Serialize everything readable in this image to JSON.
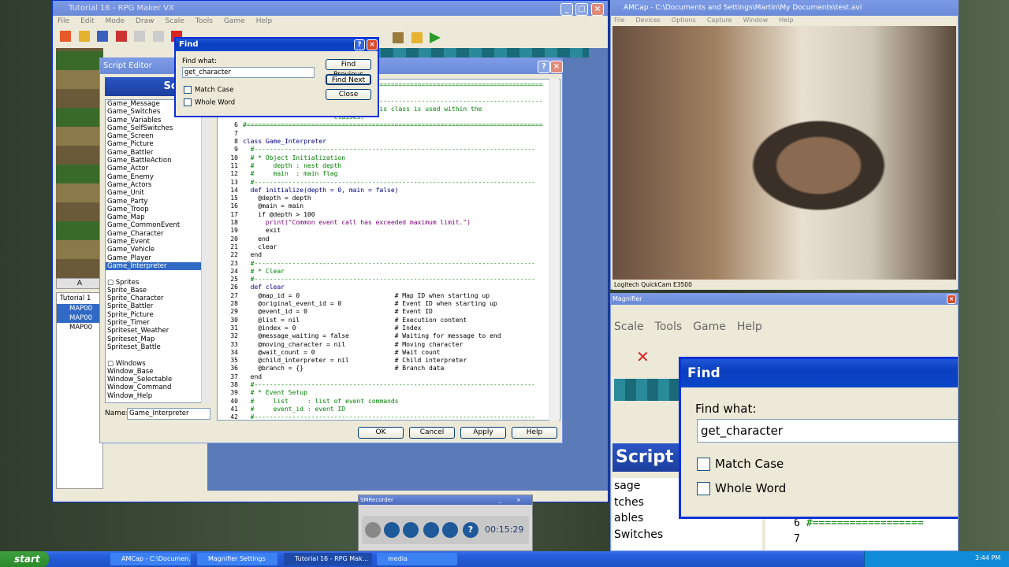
{
  "rpg": {
    "title": "Tutorial 16 - RPG Maker VX",
    "menu": [
      "File",
      "Edit",
      "Mode",
      "Draw",
      "Scale",
      "Tools",
      "Game",
      "Help"
    ]
  },
  "script_editor": {
    "title": "Script Editor",
    "header": "Script",
    "list": [
      "Game_Message",
      "Game_Switches",
      "Game_Variables",
      "Game_SelfSwitches",
      "Game_Screen",
      "Game_Picture",
      "Game_Battler",
      "Game_BattleAction",
      "Game_Actor",
      "Game_Enemy",
      "Game_Actors",
      "Game_Unit",
      "Game_Party",
      "Game_Troop",
      "Game_Map",
      "Game_CommonEvent",
      "Game_Character",
      "Game_Event",
      "Game_Vehicle",
      "Game_Player",
      "Game_Interpreter",
      "",
      "▢ Sprites",
      "Sprite_Base",
      "Sprite_Character",
      "Sprite_Battler",
      "Sprite_Picture",
      "Sprite_Timer",
      "Spriteset_Weather",
      "Spriteset_Map",
      "Spriteset_Battle",
      "",
      "▢ Windows",
      "Window_Base",
      "Window_Selectable",
      "Window_Command",
      "Window_Help"
    ],
    "selected_index": 20,
    "name_label": "Name:",
    "name_value": "Game_Interpreter",
    "buttons": {
      "ok": "OK",
      "cancel": "Cancel",
      "apply": "Apply",
      "help": "Help"
    },
    "code_lines": [
      {
        "n": "",
        "t": "#==============================================================================",
        "c": "cm"
      },
      {
        "n": "",
        "t": "",
        "c": ""
      },
      {
        "n": "",
        "t": "#------------------------------------------------------------------------------",
        "c": "cm"
      },
      {
        "n": "",
        "t": "                        commands. This class is used within the",
        "c": "cm"
      },
      {
        "n": "",
        "t": "                        classes.",
        "c": "cm"
      },
      {
        "n": "6",
        "t": "#==============================================================================",
        "c": "cm"
      },
      {
        "n": "7",
        "t": "",
        "c": ""
      },
      {
        "n": "8",
        "t": "class Game_Interpreter",
        "c": "kw"
      },
      {
        "n": "9",
        "t": "  #--------------------------------------------------------------------------",
        "c": "cm"
      },
      {
        "n": "10",
        "t": "  # * Object Initialization",
        "c": "cm"
      },
      {
        "n": "11",
        "t": "  #     depth : nest depth",
        "c": "cm"
      },
      {
        "n": "12",
        "t": "  #     main  : main flag",
        "c": "cm"
      },
      {
        "n": "13",
        "t": "  #--------------------------------------------------------------------------",
        "c": "cm"
      },
      {
        "n": "14",
        "t": "  def initialize(depth = 0, main = false)",
        "c": "kw"
      },
      {
        "n": "15",
        "t": "    @depth = depth",
        "c": ""
      },
      {
        "n": "16",
        "t": "    @main = main",
        "c": ""
      },
      {
        "n": "17",
        "t": "    if @depth > 100",
        "c": ""
      },
      {
        "n": "18",
        "t": "      print(\"Common event call has exceeded maximum limit.\")",
        "c": "st"
      },
      {
        "n": "19",
        "t": "      exit",
        "c": ""
      },
      {
        "n": "20",
        "t": "    end",
        "c": ""
      },
      {
        "n": "21",
        "t": "    clear",
        "c": ""
      },
      {
        "n": "22",
        "t": "  end",
        "c": ""
      },
      {
        "n": "23",
        "t": "  #--------------------------------------------------------------------------",
        "c": "cm"
      },
      {
        "n": "24",
        "t": "  # * Clear",
        "c": "cm"
      },
      {
        "n": "25",
        "t": "  #--------------------------------------------------------------------------",
        "c": "cm"
      },
      {
        "n": "26",
        "t": "  def clear",
        "c": "kw"
      },
      {
        "n": "27",
        "t": "    @map_id = 0                         # Map ID when starting up",
        "c": ""
      },
      {
        "n": "28",
        "t": "    @original_event_id = 0              # Event ID when starting up",
        "c": ""
      },
      {
        "n": "29",
        "t": "    @event_id = 0                       # Event ID",
        "c": ""
      },
      {
        "n": "30",
        "t": "    @list = nil                         # Execution content",
        "c": ""
      },
      {
        "n": "31",
        "t": "    @index = 0                          # Index",
        "c": ""
      },
      {
        "n": "32",
        "t": "    @message_waiting = false            # Waiting for message to end",
        "c": ""
      },
      {
        "n": "33",
        "t": "    @moving_character = nil             # Moving character",
        "c": ""
      },
      {
        "n": "34",
        "t": "    @wait_count = 0                     # Wait count",
        "c": ""
      },
      {
        "n": "35",
        "t": "    @child_interpreter = nil            # Child interpreter",
        "c": ""
      },
      {
        "n": "36",
        "t": "    @branch = {}                        # Branch data",
        "c": ""
      },
      {
        "n": "37",
        "t": "  end",
        "c": ""
      },
      {
        "n": "38",
        "t": "  #--------------------------------------------------------------------------",
        "c": "cm"
      },
      {
        "n": "39",
        "t": "  # * Event Setup",
        "c": "cm"
      },
      {
        "n": "40",
        "t": "  #     list     : list of event commands",
        "c": "cm"
      },
      {
        "n": "41",
        "t": "  #     event_id : event ID",
        "c": "cm"
      },
      {
        "n": "42",
        "t": "  #--------------------------------------------------------------------------",
        "c": "cm"
      }
    ]
  },
  "find": {
    "title": "Find",
    "find_what_label": "Find what:",
    "find_what_value": "get_character",
    "match_case": "Match Case",
    "whole_word": "Whole Word",
    "find_previous": "Find Previous",
    "find_next": "Find Next",
    "close": "Close"
  },
  "maptree": {
    "root": "Tutorial 1",
    "items": [
      "MAP00",
      "MAP00",
      "MAP00"
    ],
    "tab": "A"
  },
  "amcap": {
    "title": "AMCap - C:\\Documents and Settings\\Martin\\My Documents\\test.avi",
    "menu": [
      "File",
      "Devices",
      "Options",
      "Capture",
      "Window",
      "Help"
    ],
    "status": "Logitech QuickCam E3500"
  },
  "magnifier": {
    "title": "Magnifier",
    "menu": [
      "Scale",
      "Tools",
      "Game",
      "Help"
    ],
    "script_header": "Script",
    "list": [
      "sage",
      "tches",
      "ables",
      "Switches"
    ],
    "line_nums": [
      "6",
      "7"
    ],
    "code_fragment": "#=================="
  },
  "recorder": {
    "title": "SMRecorder",
    "time": "00:15:29"
  },
  "taskbar": {
    "start": "start",
    "items": [
      "AMCap - C:\\Documen...",
      "Magnifier Settings",
      "Tutorial 16 - RPG Mak...",
      "media"
    ],
    "clock": "3:44 PM"
  }
}
